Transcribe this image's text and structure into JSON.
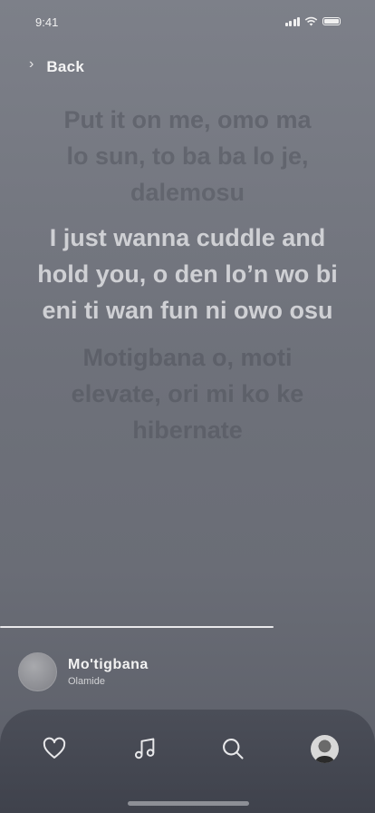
{
  "status_bar": {
    "time": "9:41"
  },
  "nav": {
    "back_label": "Back"
  },
  "lyrics": {
    "previous": "Put it on me, omo ma lo sun, to ba ba lo je, dalemosu",
    "current": "I just wanna cuddle and hold you, o den lo’n wo bi eni ti wan fun ni owo osu",
    "next": "Motigbana o, moti elevate, ori mi ko ke hibernate"
  },
  "progress": {
    "fraction": 0.73
  },
  "now_playing": {
    "title": "Mo'tigbana",
    "artist": "Olamide"
  },
  "tabbar": {
    "items": [
      {
        "icon": "heart-icon"
      },
      {
        "icon": "music-note-icon"
      },
      {
        "icon": "search-icon"
      },
      {
        "icon": "profile-avatar"
      }
    ]
  },
  "colors": {
    "background_top": "#7d8089",
    "background_bottom": "#5a5d67",
    "tabbar": "#45484f",
    "lyric_active": "#cfd0d4",
    "lyric_inactive": "#62656e"
  }
}
